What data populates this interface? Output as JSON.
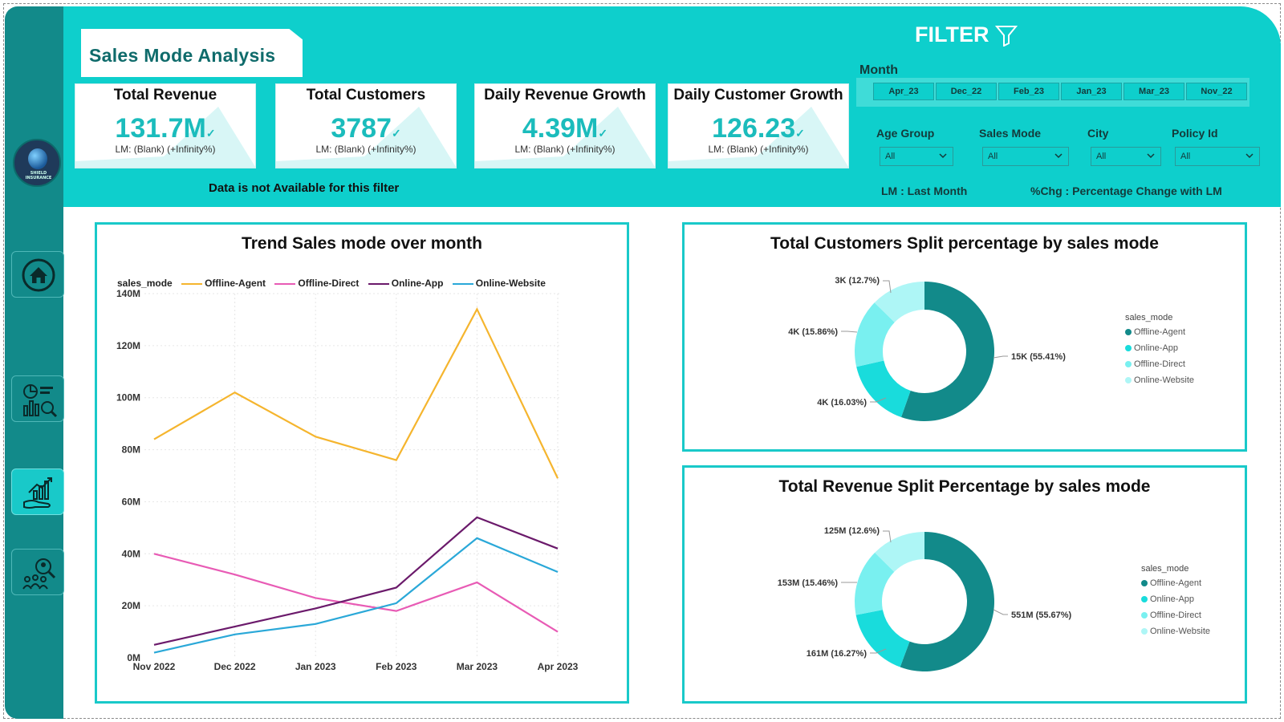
{
  "title": "Sales Mode Analysis",
  "logo_text": "SHIELD INSURANCE",
  "kpis": [
    {
      "title": "Total Revenue",
      "value": "131.7M",
      "sub": "LM: (Blank) (+Infinity%)"
    },
    {
      "title": "Total Customers",
      "value": "3787",
      "sub": "LM: (Blank) (+Infinity%)"
    },
    {
      "title": "Daily Revenue Growth",
      "value": "4.39M",
      "sub": "LM: (Blank) (+Infinity%)"
    },
    {
      "title": "Daily Customer Growth",
      "value": "126.23",
      "sub": "LM: (Blank) (+Infinity%)"
    }
  ],
  "notice": "Data is not Available for this filter",
  "filter": {
    "title": "FILTER",
    "month_label": "Month",
    "months": [
      "Apr_23",
      "Dec_22",
      "Feb_23",
      "Jan_23",
      "Mar_23",
      "Nov_22"
    ],
    "slicers": [
      {
        "label": "Age Group",
        "value": "All"
      },
      {
        "label": "Sales Mode",
        "value": "All"
      },
      {
        "label": "City",
        "value": "All"
      },
      {
        "label": "Policy Id",
        "value": "All"
      }
    ],
    "note_lm": "LM : Last Month",
    "note_chg": "%Chg : Percentage Change with LM"
  },
  "colors": {
    "header": "#0ecfcc",
    "sidebar": "#128a8a",
    "accent": "#19c9c9"
  },
  "trend_chart": {
    "title": "Trend Sales mode over month",
    "legend_title": "sales_mode",
    "y_ticks": [
      "0M",
      "20M",
      "40M",
      "60M",
      "80M",
      "100M",
      "120M",
      "140M"
    ],
    "chart_data": {
      "type": "line",
      "x": [
        "Nov 2022",
        "Dec 2022",
        "Jan 2023",
        "Feb 2023",
        "Mar 2023",
        "Apr 2023"
      ],
      "ylim": [
        0,
        140
      ],
      "series": [
        {
          "name": "Offline-Agent",
          "color": "#f5b52e",
          "values": [
            84,
            102,
            85,
            76,
            134,
            69
          ]
        },
        {
          "name": "Offline-Direct",
          "color": "#e85bb5",
          "values": [
            40,
            32,
            23,
            18,
            29,
            10
          ]
        },
        {
          "name": "Online-App",
          "color": "#6b1a6b",
          "values": [
            5,
            12,
            19,
            27,
            54,
            42
          ]
        },
        {
          "name": "Online-Website",
          "color": "#2aa8d8",
          "values": [
            2,
            9,
            13,
            21,
            46,
            33
          ]
        }
      ]
    }
  },
  "customers_donut": {
    "title": "Total Customers Split percentage by sales mode",
    "legend_title": "sales_mode",
    "chart_data": {
      "type": "pie",
      "labels": [
        "Offline-Agent",
        "Online-App",
        "Offline-Direct",
        "Online-Website"
      ],
      "values": [
        55.41,
        16.03,
        15.86,
        12.7
      ],
      "data_labels": [
        "15K (55.41%)",
        "4K (16.03%)",
        "4K (15.86%)",
        "3K (12.7%)"
      ],
      "colors": [
        "#128a8a",
        "#19dcdc",
        "#79f0f0",
        "#aef6f6"
      ]
    }
  },
  "revenue_donut": {
    "title": "Total Revenue Split Percentage by sales mode",
    "legend_title": "sales_mode",
    "chart_data": {
      "type": "pie",
      "labels": [
        "Offline-Agent",
        "Online-App",
        "Offline-Direct",
        "Online-Website"
      ],
      "values": [
        55.67,
        16.27,
        15.46,
        12.6
      ],
      "data_labels": [
        "551M (55.67%)",
        "161M (16.27%)",
        "153M (15.46%)",
        "125M (12.6%)"
      ],
      "colors": [
        "#128a8a",
        "#19dcdc",
        "#79f0f0",
        "#aef6f6"
      ]
    }
  }
}
